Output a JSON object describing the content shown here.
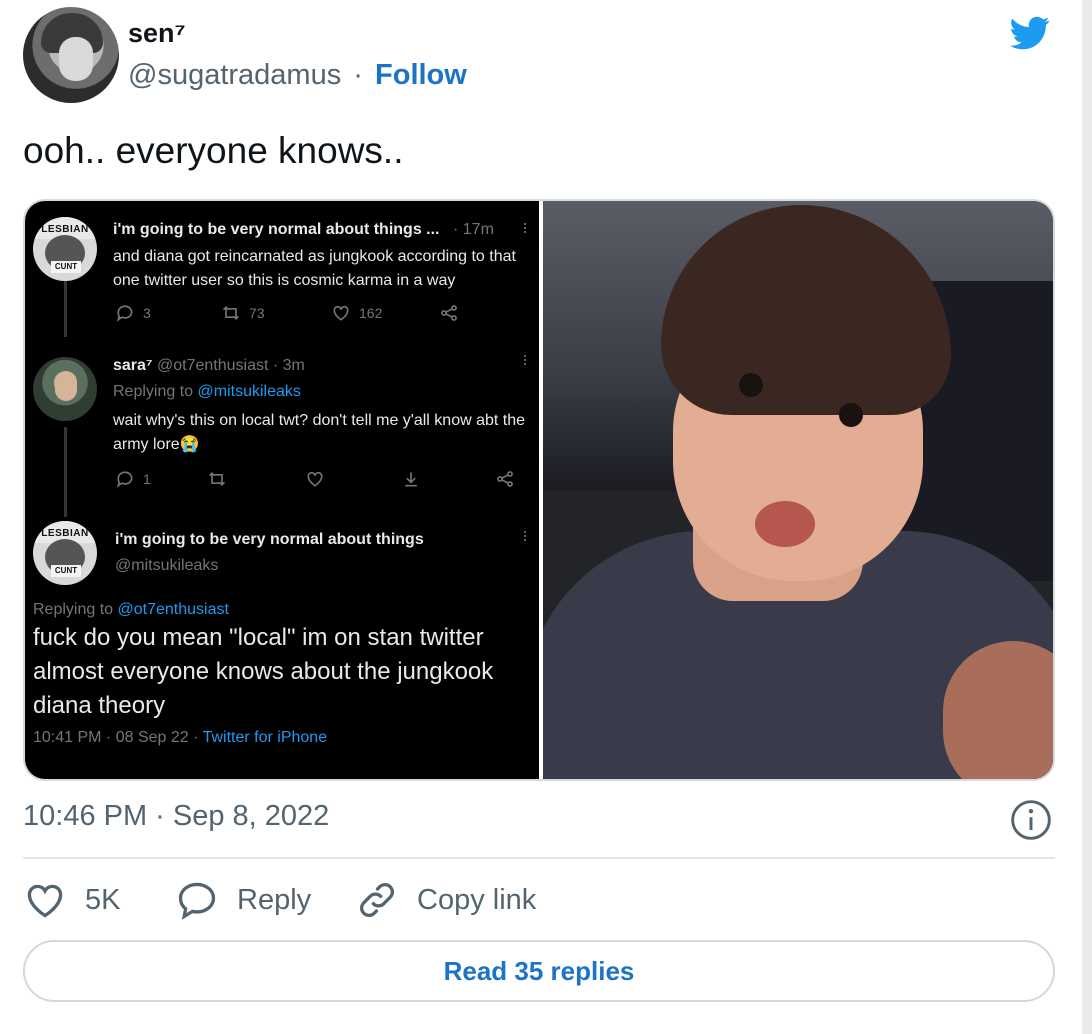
{
  "author": {
    "display_name": "sen⁷",
    "handle": "@sugatradamus",
    "separator": "·",
    "follow_label": "Follow"
  },
  "tweet": {
    "text": "ooh.. everyone knows..",
    "timestamp": "10:46 PM · Sep 8, 2022"
  },
  "embedded_screenshot": {
    "tweet1": {
      "name": "i'm going to be very normal about things ...",
      "time": "· 17m",
      "avatar_top": "LESBIAN",
      "avatar_bottom": "CUNT",
      "body": "and diana got reincarnated as jungkook according to that one twitter user so this is cosmic karma in a way",
      "replies": "3",
      "retweets": "73",
      "likes": "162"
    },
    "tweet2": {
      "name": "sara⁷",
      "meta": "@ot7enthusiast · 3m",
      "replying_prefix": "Replying to",
      "replying_to": "@mitsukileaks",
      "body": "wait why's this on local twt? don't tell me y'all know abt the army lore😭",
      "replies": "1"
    },
    "tweet3": {
      "name": "i'm going to be very normal about things",
      "handle": "@mitsukileaks",
      "avatar_top": "LESBIAN",
      "avatar_bottom": "CUNT",
      "replying_prefix": "Replying to",
      "replying_to": "@ot7enthusiast",
      "body": "fuck do you mean \"local\" im on stan twitter almost everyone knows about the jungkook diana theory",
      "footer_time": "10:41 PM · 08 Sep 22 ·",
      "footer_source": "Twitter for iPhone"
    }
  },
  "actions": {
    "like_count": "5K",
    "reply_label": "Reply",
    "copy_label": "Copy link"
  },
  "read_replies_label": "Read 35 replies",
  "colors": {
    "link_blue": "#1d74c4",
    "twitter_blue": "#1d9bf0",
    "muted_text": "#536471"
  },
  "icons": {
    "logo": "twitter-bird-icon",
    "info": "info-icon",
    "like": "heart-icon",
    "reply": "speech-bubble-icon",
    "copy": "link-icon"
  }
}
